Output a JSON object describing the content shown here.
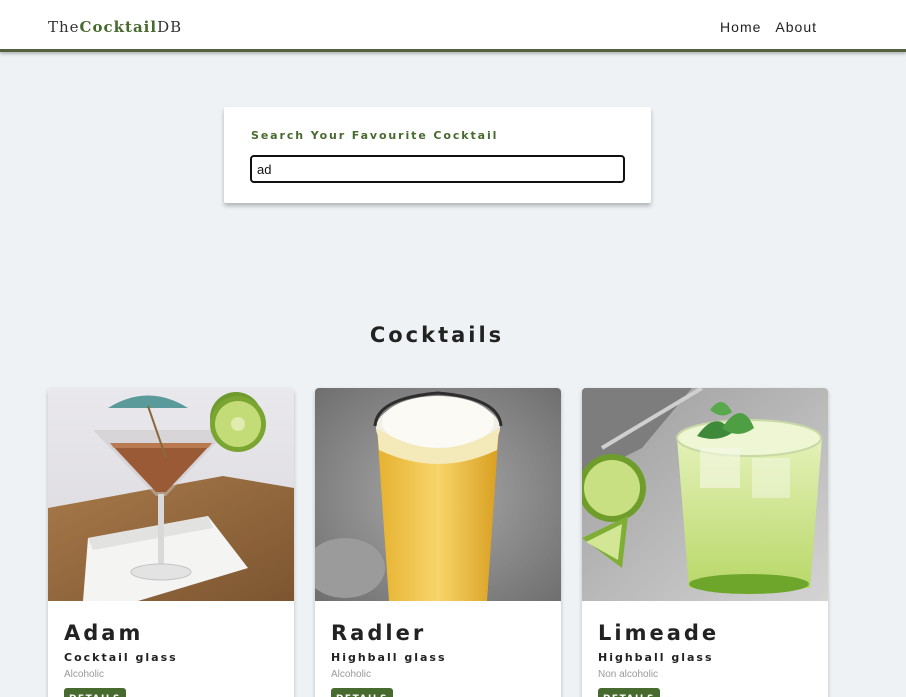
{
  "navbar": {
    "logo_prefix": "The",
    "logo_accent": "Cocktail",
    "logo_suffix": "DB",
    "links": [
      {
        "label": "Home"
      },
      {
        "label": "About"
      }
    ]
  },
  "search": {
    "label": "Search Your Favourite Cocktail",
    "value": "ad"
  },
  "section": {
    "title": "Cocktails"
  },
  "cocktails": [
    {
      "name": "Adam",
      "glass": "Cocktail glass",
      "info": "Alcoholic",
      "button": "DETAILS",
      "image_icon": "martini-glass-photo"
    },
    {
      "name": "Radler",
      "glass": "Highball glass",
      "info": "Alcoholic",
      "button": "DETAILS",
      "image_icon": "beer-pint-photo"
    },
    {
      "name": "Limeade",
      "glass": "Highball glass",
      "info": "Non alcoholic",
      "button": "DETAILS",
      "image_icon": "lime-drink-photo"
    }
  ],
  "colors": {
    "accent": "#476a2e",
    "navbar_border": "#55603f",
    "background": "#eef2f4"
  }
}
